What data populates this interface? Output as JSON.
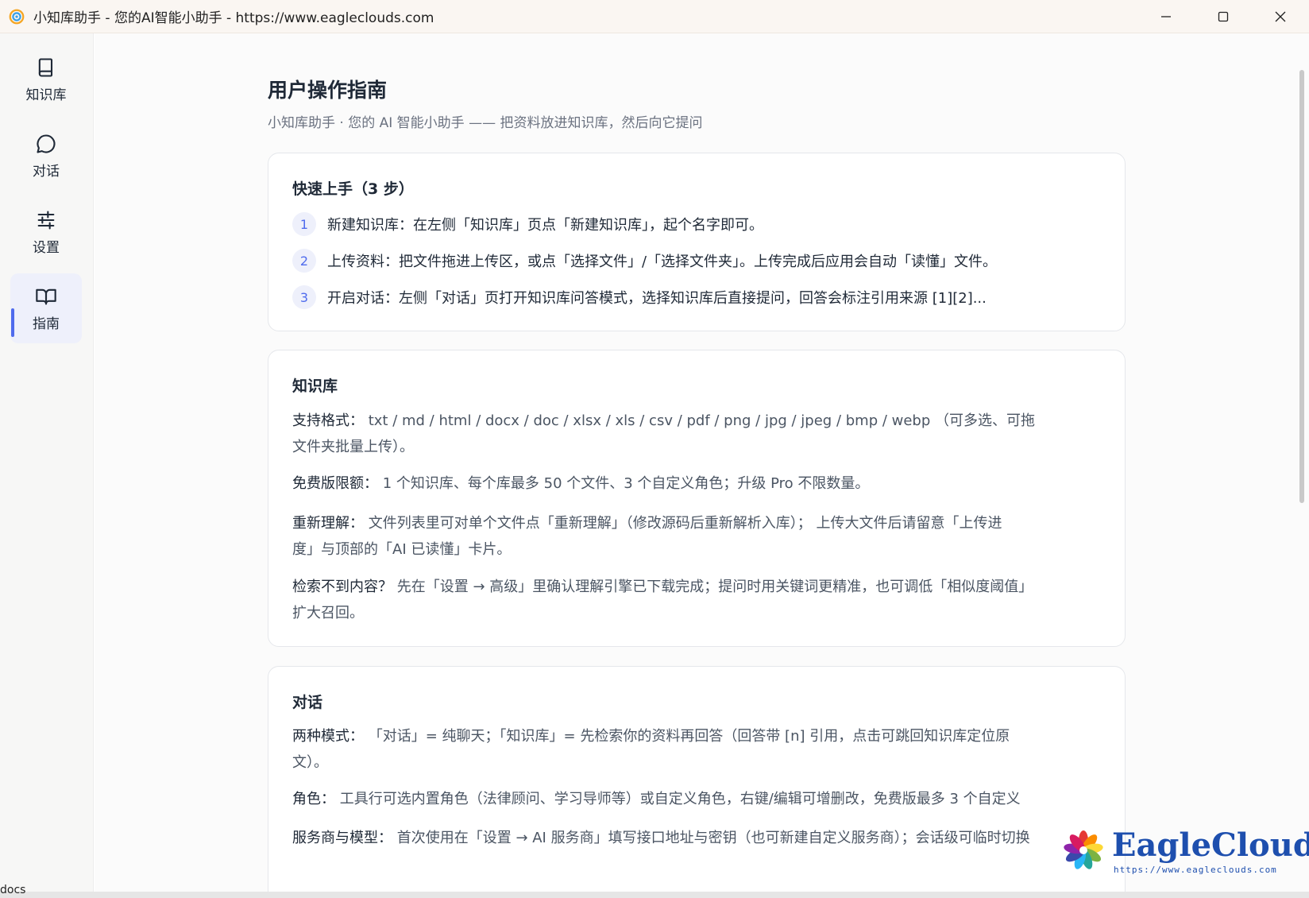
{
  "window": {
    "title": "小知库助手 - 您的AI智能小助手 - https://www.eagleclouds.com"
  },
  "sidebar": {
    "items": [
      {
        "label": "知识库",
        "icon": "book-icon"
      },
      {
        "label": "对话",
        "icon": "chat-bubble-icon"
      },
      {
        "label": "设置",
        "icon": "sliders-icon"
      },
      {
        "label": "指南",
        "icon": "open-book-icon",
        "active": true
      }
    ]
  },
  "main": {
    "title": "用户操作指南",
    "subtitle": "小知库助手 · 您的 AI 智能小助手 —— 把资料放进知识库，然后向它提问",
    "quickstart": {
      "title": "快速上手（3 步）",
      "steps": [
        {
          "num": "1",
          "text": "新建知识库：在左侧「知识库」页点「新建知识库」，起个名字即可。"
        },
        {
          "num": "2",
          "text": "上传资料：把文件拖进上传区，或点「选择文件」/「选择文件夹」。上传完成后应用会自动「读懂」文件。"
        },
        {
          "num": "3",
          "text": "开启对话：左侧「对话」页打开知识库问答模式，选择知识库后直接提问，回答会标注引用来源 [1][2]..."
        }
      ]
    },
    "kb": {
      "title": "知识库",
      "paras": [
        {
          "key": "支持格式：",
          "line1": " txt / md / html / docx / doc / xlsx / xls / csv / pdf / png / jpg / jpeg / bmp / webp （可多选、可拖",
          "line2": "文件夹批量上传）。"
        },
        {
          "key": "免费版限额：",
          "line1": " 1 个知识库、每个库最多 50 个文件、3 个自定义角色；升级 Pro 不限数量。",
          "line2": ""
        },
        {
          "key": "重新理解：",
          "line1": " 文件列表里可对单个文件点「重新理解」（修改源码后重新解析入库）； 上传大文件后请留意「上传进",
          "line2": "度」与顶部的「AI 已读懂」卡片。"
        },
        {
          "key": "检索不到内容？",
          "line1": " 先在「设置 → 高级」里确认理解引擎已下载完成；提问时用关键词更精准，也可调低「相似度阈值」",
          "line2": "扩大召回。"
        }
      ]
    },
    "chat": {
      "title": "对话",
      "paras": [
        {
          "key": "两种模式：",
          "line1": " 「对话」= 纯聊天；「知识库」= 先检索你的资料再回答（回答带 [n] 引用，点击可跳回知识库定位原",
          "line2": "文）。"
        },
        {
          "key": "角色：",
          "line1": " 工具行可选内置角色（法律顾问、学习导师等）或自定义角色，右键/编辑可增删改，免费版最多 3 个自定义",
          "line2": ""
        },
        {
          "key": "服务商与模型：",
          "line1": " 首次使用在「设置 → AI 服务商」填写接口地址与密钥（也可新建自定义服务商）；会话级可临时切换",
          "line2": ""
        }
      ]
    }
  },
  "watermark": {
    "brand": "EagleClouds",
    "url": "https://www.eagleclouds.com"
  },
  "taskbar": {
    "fragment": "docs"
  },
  "colors": {
    "accent": "#4f6bed",
    "active_bg": "#eef0fb",
    "brand_blue": "#1e4fae"
  }
}
